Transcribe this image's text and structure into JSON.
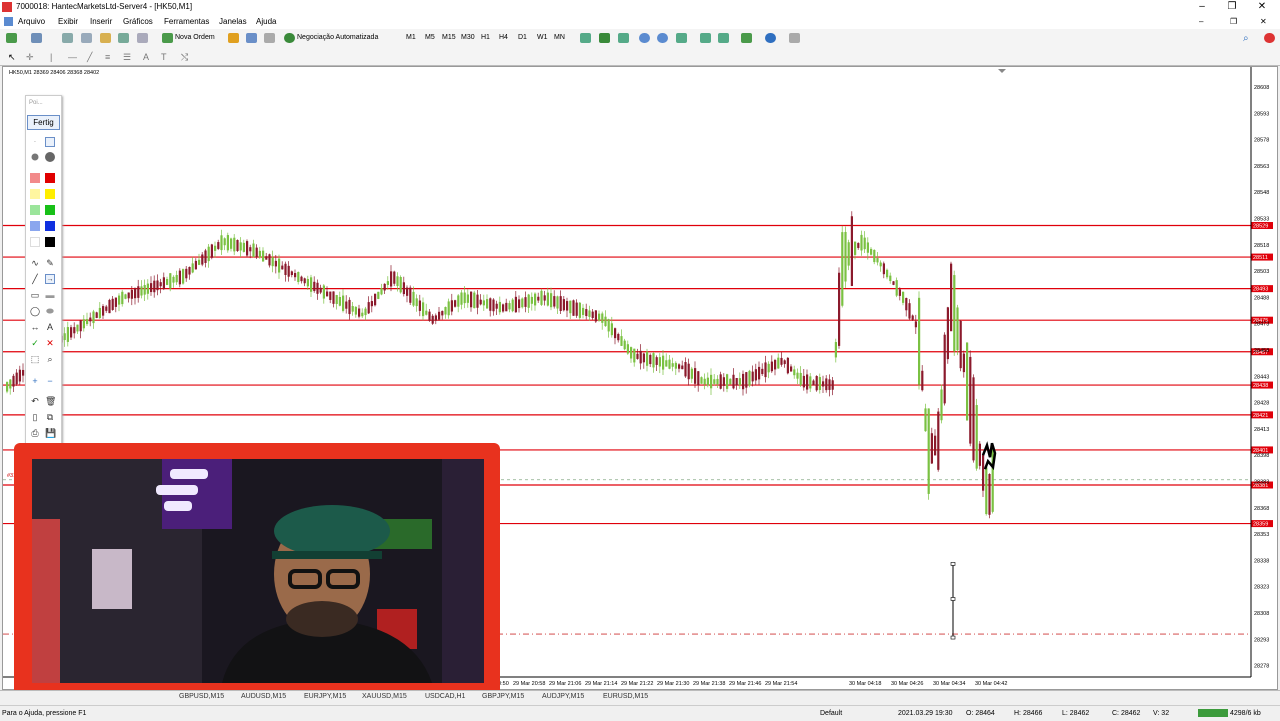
{
  "window": {
    "title": "7000018: HantecMarketsLtd-Server4 - [HK50,M1]"
  },
  "menu": [
    "Arquivo",
    "Exibir",
    "Inserir",
    "Gráficos",
    "Ferramentas",
    "Janelas",
    "Ajuda"
  ],
  "toolbar": {
    "new_order": "Nova Ordem",
    "auto_trading": "Negociação Automatizada",
    "timeframes": [
      "M1",
      "M5",
      "M15",
      "M30",
      "H1",
      "H4",
      "D1",
      "W1",
      "MN"
    ]
  },
  "chart": {
    "symbol_info": "HK50,M1  28369 28406 28368 28402",
    "marker_label": "#319",
    "price_ticks": [
      "28608",
      "28593",
      "28578",
      "28563",
      "28548",
      "28533",
      "28518",
      "28503",
      "28488",
      "28473",
      "28458",
      "28443",
      "28428",
      "28413",
      "28398",
      "28383",
      "28368",
      "28353",
      "28338",
      "28323",
      "28308",
      "28293",
      "28278"
    ],
    "level_labels": [
      "28529",
      "28511",
      "28493",
      "28475",
      "28457",
      "28438",
      "28421",
      "28401",
      "28381",
      "28359"
    ],
    "time_ticks": [
      "20:50",
      "29 Mar 20:58",
      "29 Mar 21:06",
      "29 Mar 21:14",
      "29 Mar 21:22",
      "29 Mar 21:30",
      "29 Mar 21:38",
      "29 Mar 21:46",
      "29 Mar 21:54",
      "30 Mar 04:18",
      "30 Mar 04:26",
      "30 Mar 04:34",
      "30 Mar 04:42"
    ],
    "colors": {
      "up": "#7ac142",
      "down": "#8b1a2c",
      "level": "#e0000a"
    }
  },
  "draw_palette": {
    "faded_label": "Poi...",
    "done_button": "Fertig"
  },
  "tabs": [
    "GBPUSD,M15",
    "AUDUSD,M15",
    "EURJPY,M15",
    "XAUUSD,M15",
    "USDCAD,H1",
    "GBPJPY,M15",
    "AUDJPY,M15",
    "EURUSD,M15"
  ],
  "status": {
    "help": "Para o Ajuda, pressione F1",
    "profile": "Default",
    "datetime": "2021.03.29 19:30",
    "open": "O: 28464",
    "high": "H: 28466",
    "low": "L: 28462",
    "close": "C: 28462",
    "volume": "V: 32",
    "traffic": "4298/6 kb"
  }
}
